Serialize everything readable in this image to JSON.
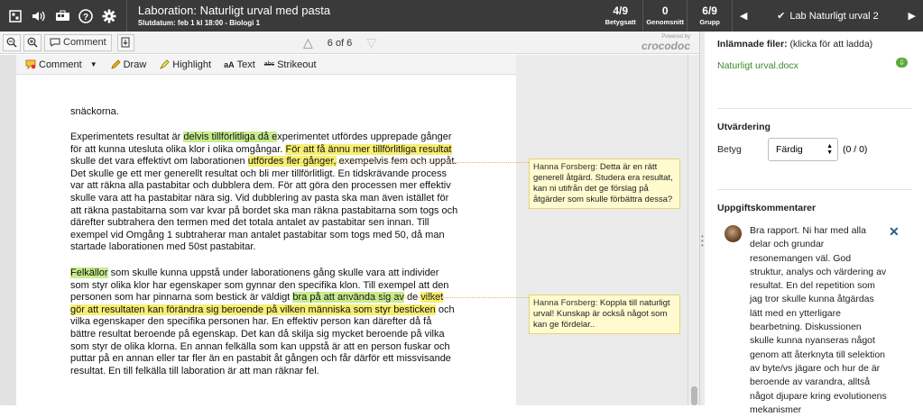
{
  "topbar": {
    "title": "Laboration: Naturligt urval med pasta",
    "subtitle": "Slutdatum: feb 1 kl 18:00 - Biologi 1",
    "stats": [
      {
        "value": "4/9",
        "label": "Betygsatt"
      },
      {
        "value": "0",
        "label": "Genomsnitt"
      },
      {
        "value": "6/9",
        "label": "Grupp"
      }
    ],
    "student": "Lab Naturligt urval 2",
    "icons": [
      "grid-icon",
      "speaker-icon",
      "bus-icon",
      "help-icon",
      "gear-icon"
    ]
  },
  "doc_toolbar": {
    "comment_label": "Comment",
    "page_indicator": "6 of 6",
    "logo_powered": "Powered by",
    "logo_name": "crocodoc"
  },
  "annotation_toolbar": {
    "comment": "Comment",
    "draw": "Draw",
    "highlight": "Highlight",
    "text": "Text",
    "strikeout": "Strikeout"
  },
  "document": {
    "p0": "snäckorna.",
    "p1": [
      {
        "t": "Experimentets resultat är ",
        "h": ""
      },
      {
        "t": "delvis tillförlitliga då e",
        "h": "g"
      },
      {
        "t": "xperimentet utfördes upprepade gånger för att kunna utesluta olika klor i olika omgångar. ",
        "h": ""
      },
      {
        "t": "För att få ännu mer tillförlitliga resultat",
        "h": "y"
      },
      {
        "t": " skulle det vara effektivt om laborationen ",
        "h": ""
      },
      {
        "t": "utfördes fler gånger,",
        "h": "y"
      },
      {
        "t": " exempelvis fem och uppåt. Det skulle ge ett mer generellt resultat och bli mer tillförlitligt. En tidskrävande process var att räkna alla pastabitar och dubblera dem. För att göra den processen mer effektiv skulle vara att ha pastabitar nära sig. Vid dubblering av pasta ska man även istället för att räkna pastabitarna som var kvar på bordet ska man räkna pastabitarna som togs och därefter subtrahera den termen med det totala antalet av pastabitar sen innan. Till exempel vid Omgång 1 subtraherar man antalet pastabitar som togs med 50, då man startade laborationen med 50st pastabitar.",
        "h": ""
      }
    ],
    "p2": [
      {
        "t": "Felkällor",
        "h": "g"
      },
      {
        "t": " som skulle kunna uppstå under laborationens gång skulle vara att individer som styr olika klor har egenskaper som gynnar den specifika klon. Till exempel att den personen som har pinnarna som bestick är väldigt ",
        "h": ""
      },
      {
        "t": "bra på att använda sig av",
        "h": "g"
      },
      {
        "t": " de ",
        "h": ""
      },
      {
        "t": "vilket gör att resultaten kan förändra sig beroende på vilken människa som styr besticken",
        "h": "y"
      },
      {
        "t": " och vilka egenskaper den specifika personen har. En effektiv person kan därefter då få bättre resultat beroende på egenskap. Det kan då skilja sig mycket beroende på vilka som styr de olika klorna. En annan felkälla som kan uppstå är att en person fuskar och puttar på en annan eller tar fler än en pastabit åt gången och får därför ett missvisande resultat. En till felkälla till laboration är att man räknar fel.",
        "h": ""
      }
    ]
  },
  "notes": [
    {
      "author": "Hanna Forsberg:",
      "text": " Detta är en rätt generell åtgärd. Studera era resultat, kan ni utifrån det ge förslag på åtgärder som skulle förbättra dessa?"
    },
    {
      "author": "Hanna Forsberg:",
      "text": " Koppla till naturligt urval! Kunskap är också något som kan ge fördelar.."
    }
  ],
  "right_panel": {
    "submitted_label": "Inlämnade filer:",
    "submitted_hint": "(klicka för att ladda)",
    "file_name": "Naturligt urval.docx",
    "evaluation_heading": "Utvärdering",
    "grade_label": "Betyg",
    "grade_value": "Färdig",
    "score": "(0 / 0)",
    "comments_heading": "Uppgiftskommentarer",
    "comment": "Bra rapport. Ni har med alla delar och grundar resonemangen väl. God struktur, analys och värdering av resultat. En del repetition som jag tror skulle kunna åtgärdas lätt med en ytterligare bearbetning. Diskussionen skulle kunna nyanseras något genom att återknyta till selektion av byte/vs jägare och hur de är beroende av varandra, alltså något djupare kring evolutionens mekanismer"
  },
  "colors": {
    "topbar": "#3a3a3a",
    "highlight_green": "#c7ec8e",
    "highlight_yellow": "#f7ee72",
    "file_link": "#3b8a2d",
    "note_bg": "#fffbcf"
  }
}
